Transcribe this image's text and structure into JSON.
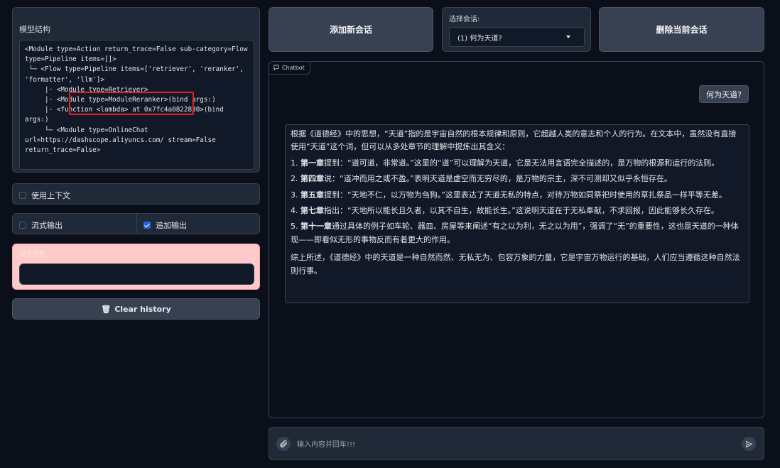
{
  "sidebar": {
    "model_structure": {
      "label": "模型结构",
      "code": "<Module type=Action return_trace=False sub-category=Flow type=Pipeline items=[]>\n └─ <Flow type=Pipeline items=['retriever', 'reranker', 'formatter', 'llm']>\n     |- <Module type=Retriever>\n     |- <Module type=ModuleReranker>(bind args:)\n     |- <function <lambda> at 0x7fc4a0822830>(bind args:)\n     └─ <Module type=OnlineChat url=https://dashscope.aliyuncs.com/ stream=False return_trace=False>"
    },
    "use_context": {
      "label": "使用上下文",
      "checked": false
    },
    "stream_output": {
      "label": "流式输出",
      "checked": false
    },
    "append_output": {
      "label": "追加输出",
      "checked": true
    },
    "error_panel": {
      "label": "报错信息",
      "value": ""
    },
    "clear_history": {
      "label": "Clear history",
      "icon": "trash-icon"
    }
  },
  "topbar": {
    "add_session_label": "添加新会话",
    "select_session_label": "选择会话:",
    "selected_session": "(1)  何为天道?",
    "delete_session_label": "删除当前会话"
  },
  "chatbot": {
    "tag_label": "Chatbot",
    "messages": [
      {
        "role": "user",
        "text": "何为天道?"
      },
      {
        "role": "assistant",
        "intro": "根据《道德经》中的思想，“天道”指的是宇宙自然的根本规律和原则，它超越人类的意志和个人的行为。在文本中，虽然没有直接使用“天道”这个词，但可以从多处章节的理解中提炼出其含义：",
        "points": [
          {
            "num": "1.",
            "head": "第一章",
            "text": "提到：“道可道，非常道。”这里的“道”可以理解为天道，它是无法用言语完全描述的，是万物的根源和运行的法则。"
          },
          {
            "num": "2.",
            "head": "第四章",
            "text": "说：“道冲而用之或不盈。”表明天道是虚空而无穷尽的，是万物的宗主，深不可测却又似乎永恒存在。"
          },
          {
            "num": "3.",
            "head": "第五章",
            "text": "提到：“天地不仁，以万物为刍狗。”这里表达了天道无私的特点，对待万物如同祭祀时使用的草扎祭品一样平等无差。"
          },
          {
            "num": "4.",
            "head": "第七章",
            "text": "指出：“天地所以能长且久者，以其不自生，故能长生。”这说明天道在于无私奉献，不求回报，因此能够长久存在。"
          },
          {
            "num": "5.",
            "head": "第十一章",
            "text": "通过具体的例子如车轮、器皿、房屋等来阐述“有之以为利，无之以为用”，强调了“无”的重要性，这也是天道的一种体现——即看似无形的事物反而有着更大的作用。"
          }
        ],
        "conclusion": "综上所述，《道德经》中的天道是一种自然而然、无私无为、包容万象的力量，它是宇宙万物运行的基础，人们应当遵循这种自然法则行事。"
      }
    ]
  },
  "input": {
    "placeholder": "输入内容并回车!!!",
    "attach_icon": "paperclip-icon",
    "send_icon": "send-icon"
  }
}
